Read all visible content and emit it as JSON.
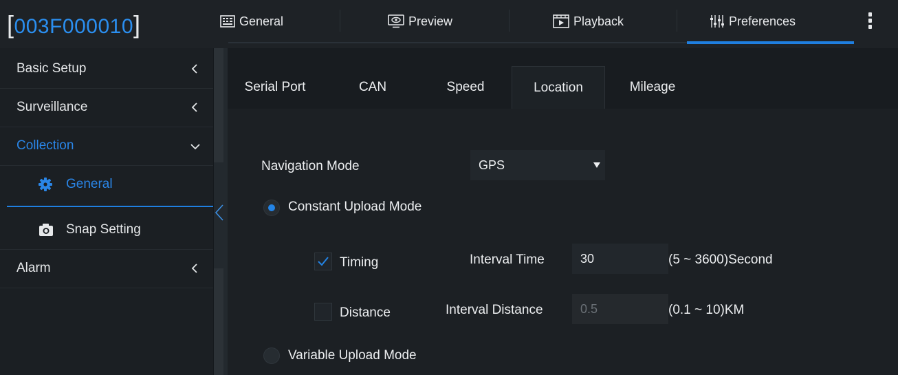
{
  "header": {
    "device_id": "003F000010",
    "bracket_open": "[",
    "bracket_close": "]",
    "tabs": [
      {
        "label": "General",
        "icon": "keyboard-icon"
      },
      {
        "label": "Preview",
        "icon": "monitor-eye-icon"
      },
      {
        "label": "Playback",
        "icon": "film-icon"
      },
      {
        "label": "Preferences",
        "icon": "sliders-icon"
      }
    ],
    "active_tab": "Preferences",
    "colors": {
      "accent": "#1f7fe0",
      "device_id": "#2b8ff0"
    }
  },
  "sidebar": {
    "items": [
      {
        "label": "Basic Setup",
        "chevron": "chevron-left-icon"
      },
      {
        "label": "Surveillance",
        "chevron": "chevron-left-icon"
      },
      {
        "label": "Collection",
        "chevron": "chevron-down-icon"
      },
      {
        "label": "General",
        "icon": "gear-icon"
      },
      {
        "label": "Snap Setting",
        "icon": "camera-icon"
      },
      {
        "label": "Alarm",
        "chevron": "chevron-left-icon"
      }
    ],
    "selected": "General"
  },
  "main": {
    "tabs": [
      {
        "label": "Serial Port"
      },
      {
        "label": "CAN"
      },
      {
        "label": "Speed"
      },
      {
        "label": "Location"
      },
      {
        "label": "Mileage"
      }
    ],
    "active_tab": "Location",
    "navigation_mode": {
      "label": "Navigation Mode",
      "value": "GPS"
    },
    "constant_upload": {
      "label": "Constant Upload Mode",
      "selected": true
    },
    "timing": {
      "label": "Timing",
      "checked": true,
      "interval_label": "Interval Time",
      "interval_value": "30",
      "range": "(5 ~ 3600)Second"
    },
    "distance": {
      "label": "Distance",
      "checked": false,
      "interval_label": "Interval Distance",
      "interval_value": "0.5",
      "range": "(0.1 ~ 10)KM"
    },
    "variable_upload": {
      "label": "Variable Upload Mode",
      "selected": false
    }
  }
}
